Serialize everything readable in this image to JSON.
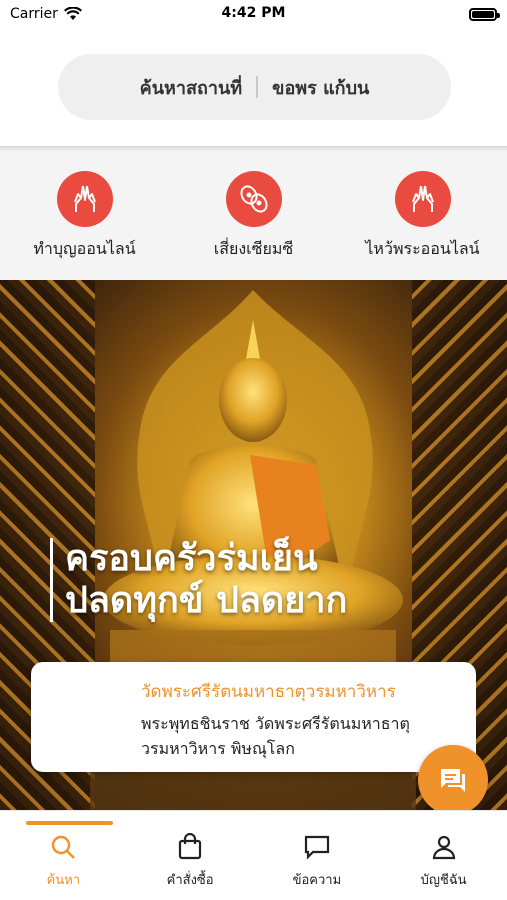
{
  "status_bar": {
    "carrier": "Carrier",
    "time": "4:42 PM"
  },
  "search": {
    "left_label": "ค้นหาสถานที่",
    "right_label": "ขอพร แก้บน"
  },
  "actions": [
    {
      "label": "ทำบุญออนไลน์",
      "icon": "praying-hands-icon"
    },
    {
      "label": "เสี่ยงเซียมซี",
      "icon": "fortune-sticks-icon"
    },
    {
      "label": "ไหว้พระออนไลน์",
      "icon": "praying-hands-icon"
    }
  ],
  "hero": {
    "slogan_line1": "ครอบครัวร่มเย็น",
    "slogan_line2": "ปลดทุกข์ ปลดยาก"
  },
  "card": {
    "title": "วัดพระศรีรัตนมหาธาตุวรมหาวิหาร",
    "desc_line1": "พระพุทธชินราช วัดพระศรีรัตนมหาธาตุ",
    "desc_line2": "วรมหาวิหาร พิษณุโลก"
  },
  "tabs": [
    {
      "label": "ค้นหา",
      "icon": "search-icon",
      "active": true
    },
    {
      "label": "คำสั่งซื้อ",
      "icon": "shopping-bag-icon",
      "active": false
    },
    {
      "label": "ข้อความ",
      "icon": "message-icon",
      "active": false
    },
    {
      "label": "บัญชีฉัน",
      "icon": "user-icon",
      "active": false
    }
  ],
  "colors": {
    "accent": "#f0922a",
    "action_red": "#e94b40"
  }
}
